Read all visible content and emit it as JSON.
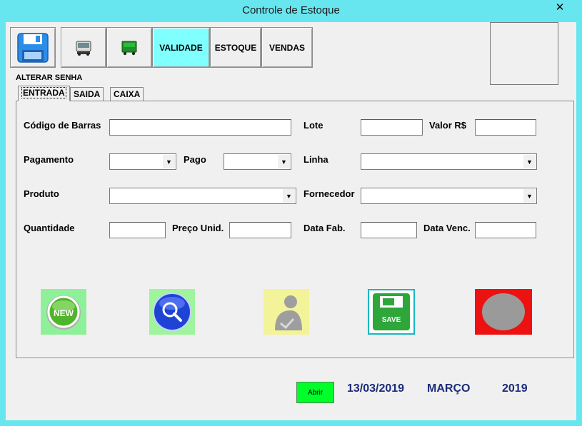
{
  "window": {
    "title": "Controle de Estoque",
    "close_glyph": "✕"
  },
  "toolbar": {
    "buttons": [
      {
        "icon": "floppy-disk-icon"
      },
      {
        "icon": "truck-icon"
      },
      {
        "icon": "green-truck-icon"
      },
      {
        "label": "VALIDADE",
        "active": true
      },
      {
        "label": "ESTOQUE"
      },
      {
        "label": "VENDAS"
      }
    ],
    "alterar_senha": "ALTERAR SENHA"
  },
  "tabs": [
    {
      "label": "ENTRADA",
      "active": true
    },
    {
      "label": "SAIDA"
    },
    {
      "label": "CAIXA"
    }
  ],
  "form": {
    "codigo_barras": {
      "label": "Código de Barras",
      "value": ""
    },
    "lote": {
      "label": "Lote",
      "value": ""
    },
    "valor": {
      "label": "Valor R$",
      "value": ""
    },
    "pagamento": {
      "label": "Pagamento",
      "value": ""
    },
    "pago": {
      "label": "Pago",
      "value": ""
    },
    "linha": {
      "label": "Linha",
      "value": ""
    },
    "produto": {
      "label": "Produto",
      "value": ""
    },
    "fornecedor": {
      "label": "Fornecedor",
      "value": ""
    },
    "quantidade": {
      "label": "Quantidade",
      "value": ""
    },
    "preco_unid": {
      "label": "Preço Unid.",
      "value": ""
    },
    "data_fab": {
      "label": "Data Fab.",
      "value": ""
    },
    "data_venc": {
      "label": "Data Venc.",
      "value": ""
    }
  },
  "actions": {
    "new_label": "NEW",
    "save_label": "SAVE"
  },
  "footer": {
    "abrir_label": "Abrir",
    "date": "13/03/2019",
    "month": "MARÇO",
    "year": "2019"
  },
  "colors": {
    "window_frame": "#68e6ef",
    "active_toolbar": "#80ffff",
    "abrir_button": "#00ff2a",
    "status_text": "#1c2a7a",
    "delete_button": "#ee1111"
  }
}
